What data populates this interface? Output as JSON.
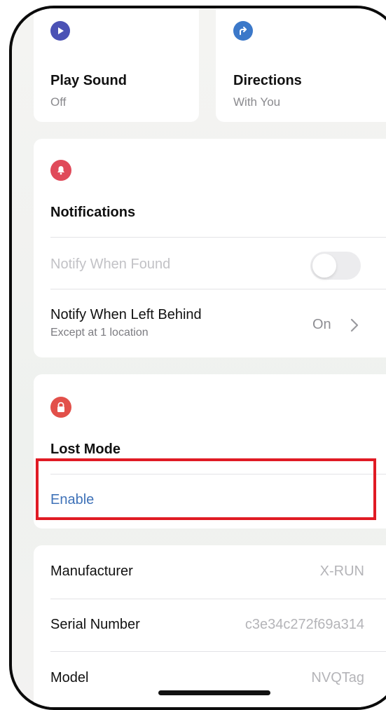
{
  "actions": {
    "play_sound": {
      "title": "Play Sound",
      "status": "Off"
    },
    "directions": {
      "title": "Directions",
      "status": "With You"
    }
  },
  "notifications": {
    "title": "Notifications",
    "notify_when_found": {
      "label": "Notify When Found",
      "enabled": false
    },
    "notify_when_left_behind": {
      "label": "Notify When Left Behind",
      "subtitle": "Except at 1 location",
      "value": "On"
    }
  },
  "lost_mode": {
    "title": "Lost Mode",
    "enable_label": "Enable"
  },
  "details": [
    {
      "label": "Manufacturer",
      "value": "X-RUN"
    },
    {
      "label": "Serial Number",
      "value": "c3e34c272f69a314"
    },
    {
      "label": "Model",
      "value": "NVQTag"
    }
  ],
  "colors": {
    "play_icon": "#4b52b5",
    "directions_icon": "#3b78c9",
    "notification_icon": "#e04a5a",
    "lost_mode_icon": "#e2504a",
    "link": "#3f72b8",
    "highlight": "#e01b24"
  },
  "icons": {
    "play_sound": "play-icon",
    "directions": "directions-arrow-icon",
    "notifications": "bell-icon",
    "lost_mode": "lock-icon",
    "disclosure": "chevron-right-icon"
  }
}
